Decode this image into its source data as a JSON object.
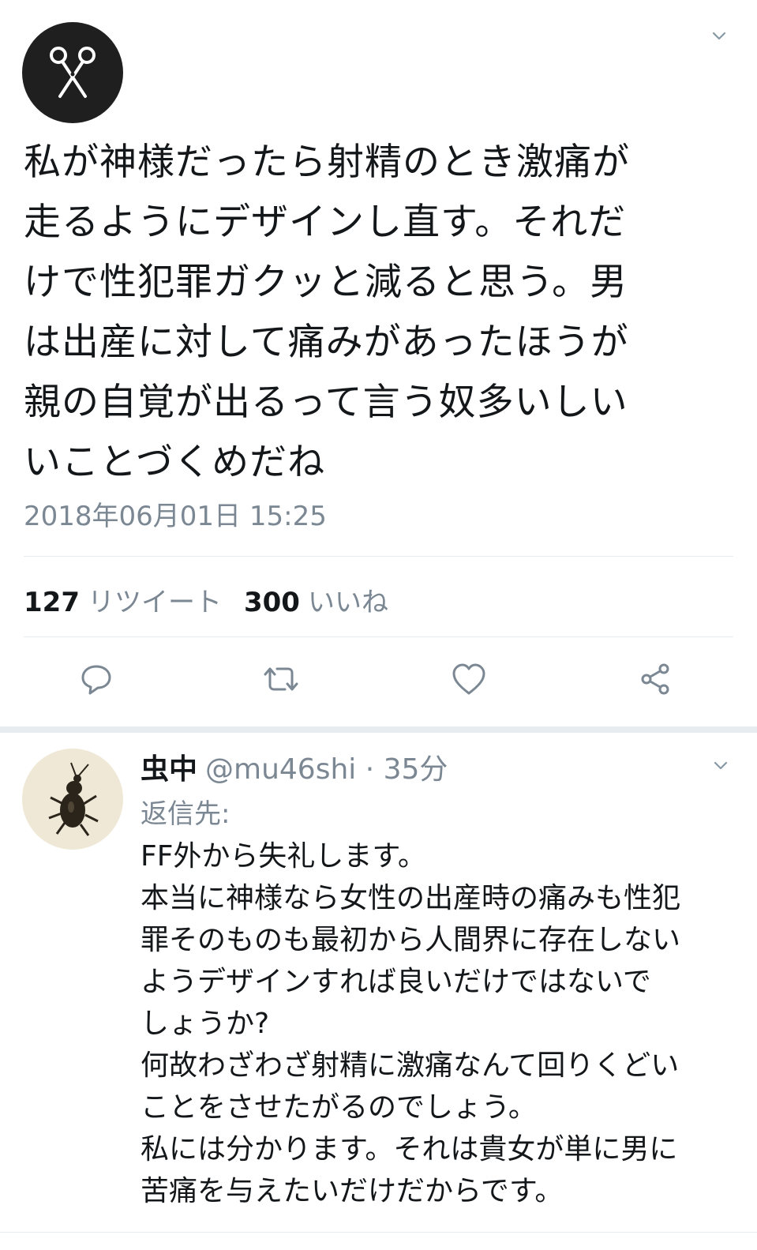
{
  "tweet": {
    "text": "私が神様だったら射精のとき激痛が\n走るようにデザインし直す。それだ\nけで性犯罪ガクッと減ると思う。男\nは出産に対して痛みがあったほうが\n親の自覚が出るって言う奴多いしい\nいことづくめだね",
    "timestamp": "2018年06月01日 15:25",
    "retweet_count": "127",
    "retweet_label": "リツイート",
    "like_count": "300",
    "like_label": "いいね"
  },
  "actions": [
    "reply-icon",
    "retweet-icon",
    "like-icon",
    "share-icon"
  ],
  "reply": {
    "name": "虫中",
    "handle": "@mu46shi · 35分",
    "reply_to": "返信先:",
    "text": "FF外から失礼します。\n本当に神様なら女性の出産時の痛みも性犯\n罪そのものも最初から人間界に存在しない\nようデザインすれば良いだけではないで\nしょうか?\n何故わざわざ射精に激痛なんて回りくどい\nことをさせたがるのでしょう。\n私には分かります。それは貴女が単に男に\n苦痛を与えたいだけだからです。"
  },
  "colors": {
    "text": "#14171a",
    "secondary": "#7b8893",
    "divider": "#e6ecf0",
    "avatar_bg": "#1f1f1f"
  }
}
